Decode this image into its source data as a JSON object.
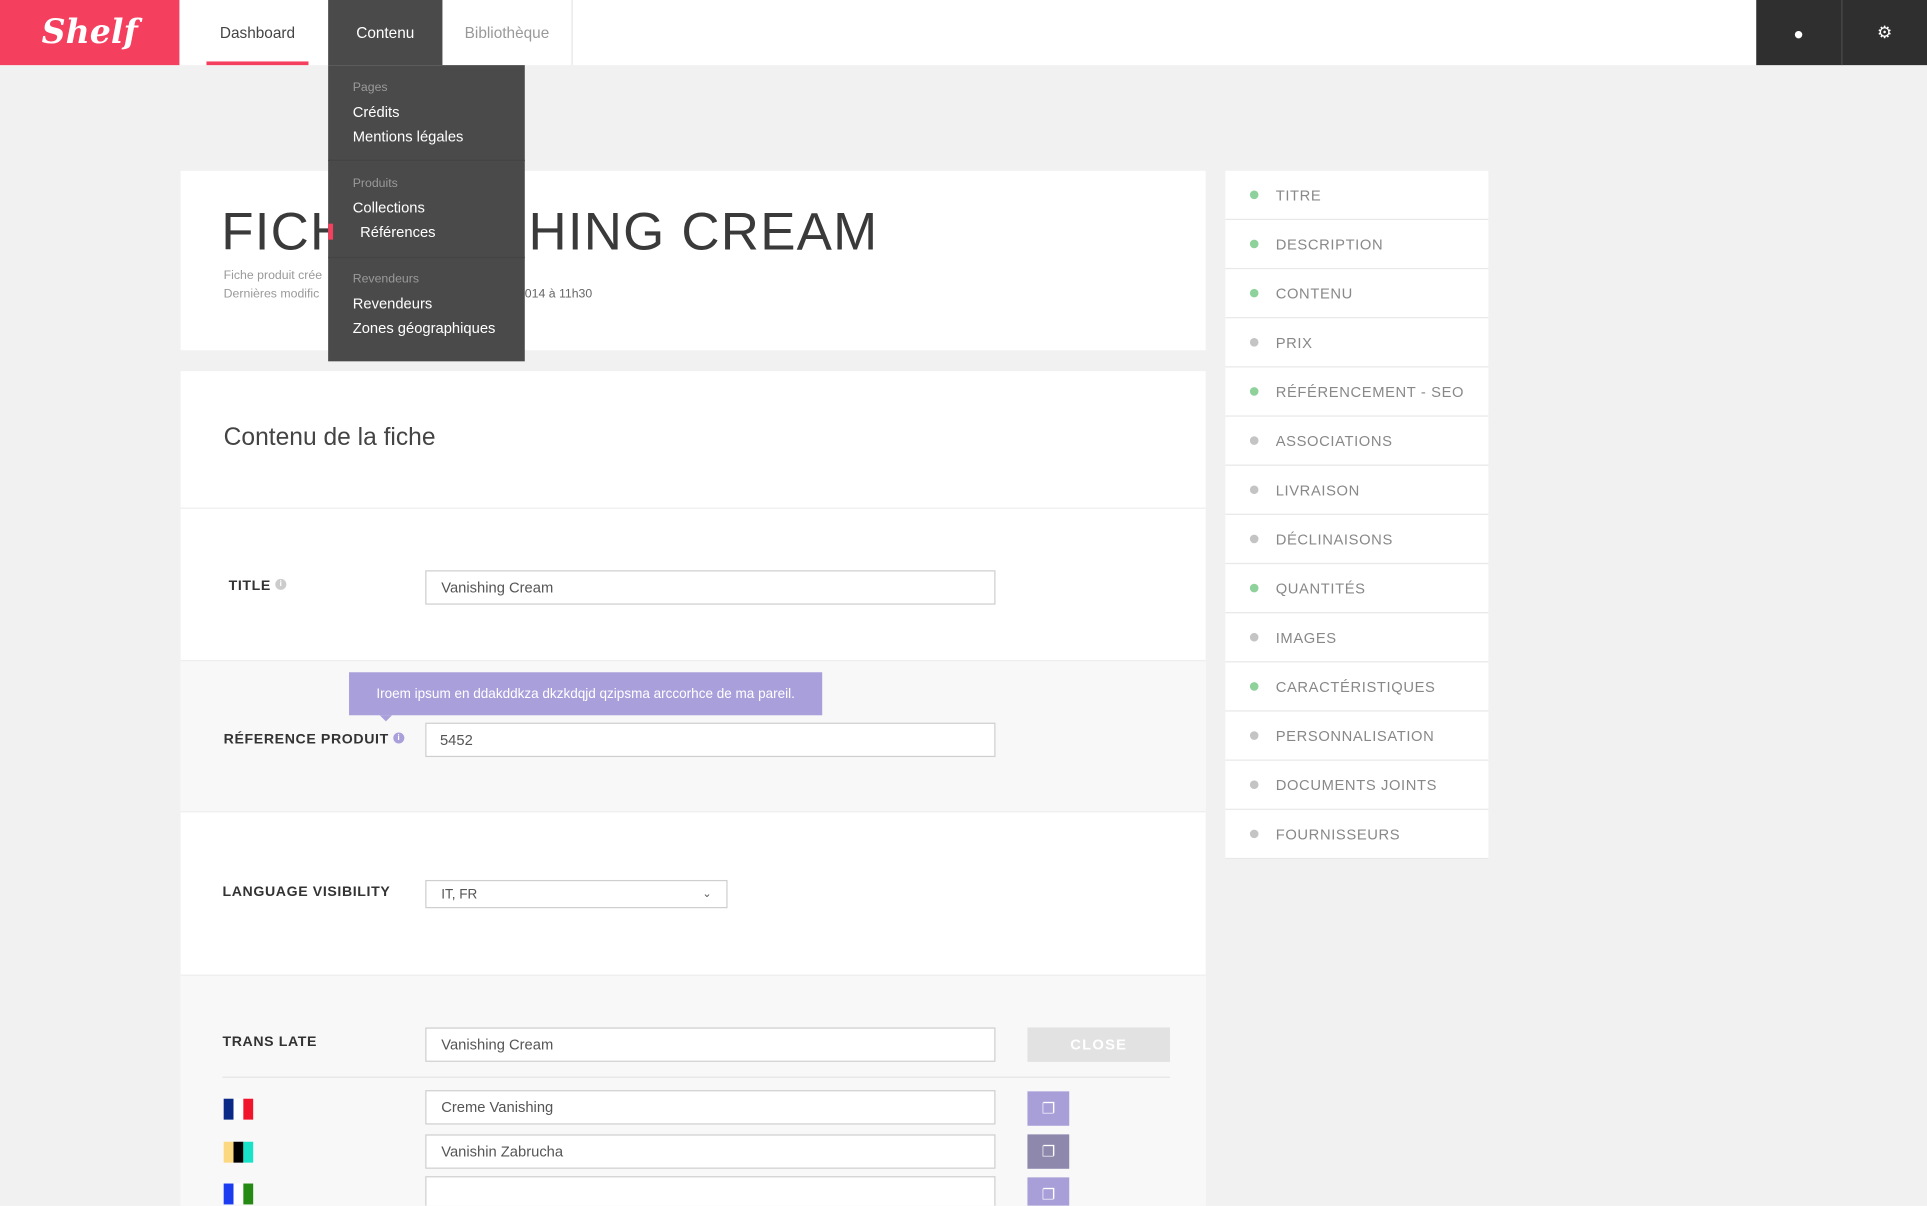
{
  "brand": {
    "logo": "Shelf",
    "color": "#f43f5e"
  },
  "nav": {
    "tabs": [
      {
        "label": "Dashboard"
      },
      {
        "label": "Contenu"
      },
      {
        "label": "Bibliothèque"
      }
    ],
    "user_icon": "user-icon",
    "settings_icon": "gear-icon"
  },
  "menu": {
    "groups": [
      {
        "label": "Pages",
        "items": [
          "Crédits",
          "Mentions légales"
        ]
      },
      {
        "label": "Produits",
        "items": [
          "Collections",
          "Références"
        ]
      },
      {
        "label": "Revendeurs",
        "items": [
          "Revendeurs",
          "Zones géographiques"
        ]
      }
    ]
  },
  "header": {
    "title_left": "FICH",
    "title_right": "HING CREAM",
    "meta1": "Fiche produit crée",
    "meta2": "Dernières modific",
    "meta2_tail": "014 à 11h30"
  },
  "section": {
    "title": "Contenu de la fiche"
  },
  "form": {
    "title_label": "TITLE",
    "title_value": "Vanishing Cream",
    "ref_label": "RÉFERENCE PRODUIT",
    "ref_value": "5452",
    "tooltip": "Iroem ipsum en ddakddkza dkzkdqjd qzipsma arccorhce de ma pareil.",
    "lang_label": "LANGUAGE VISIBILITY",
    "lang_value": "IT, FR",
    "translate_label": "TRANS LATE",
    "translate_value": "Vanishing Cream",
    "close_label": "CLOSE",
    "translations": [
      {
        "value": "Creme Vanishing"
      },
      {
        "value": "Vanishin Zabrucha"
      },
      {
        "value": ""
      }
    ]
  },
  "sidebar": {
    "items": [
      {
        "label": "TITRE",
        "status": "complete"
      },
      {
        "label": "DESCRIPTION",
        "status": "complete"
      },
      {
        "label": "CONTENU",
        "status": "complete"
      },
      {
        "label": "PRIX",
        "status": "incomplete"
      },
      {
        "label": "RÉFÉRENCEMENT - SEO",
        "status": "complete"
      },
      {
        "label": "ASSOCIATIONS",
        "status": "incomplete"
      },
      {
        "label": "LIVRAISON",
        "status": "incomplete"
      },
      {
        "label": "DÉCLINAISONS",
        "status": "incomplete"
      },
      {
        "label": "QUANTITÉS",
        "status": "complete"
      },
      {
        "label": "IMAGES",
        "status": "incomplete"
      },
      {
        "label": "CARACTÉRISTIQUES",
        "status": "complete"
      },
      {
        "label": "PERSONNALISATION",
        "status": "incomplete"
      },
      {
        "label": "DOCUMENTS JOINTS",
        "status": "incomplete"
      },
      {
        "label": "FOURNISSEURS",
        "status": "incomplete"
      }
    ],
    "colors": {
      "complete": "#8ed19b",
      "incomplete": "#c4c4c4"
    }
  }
}
